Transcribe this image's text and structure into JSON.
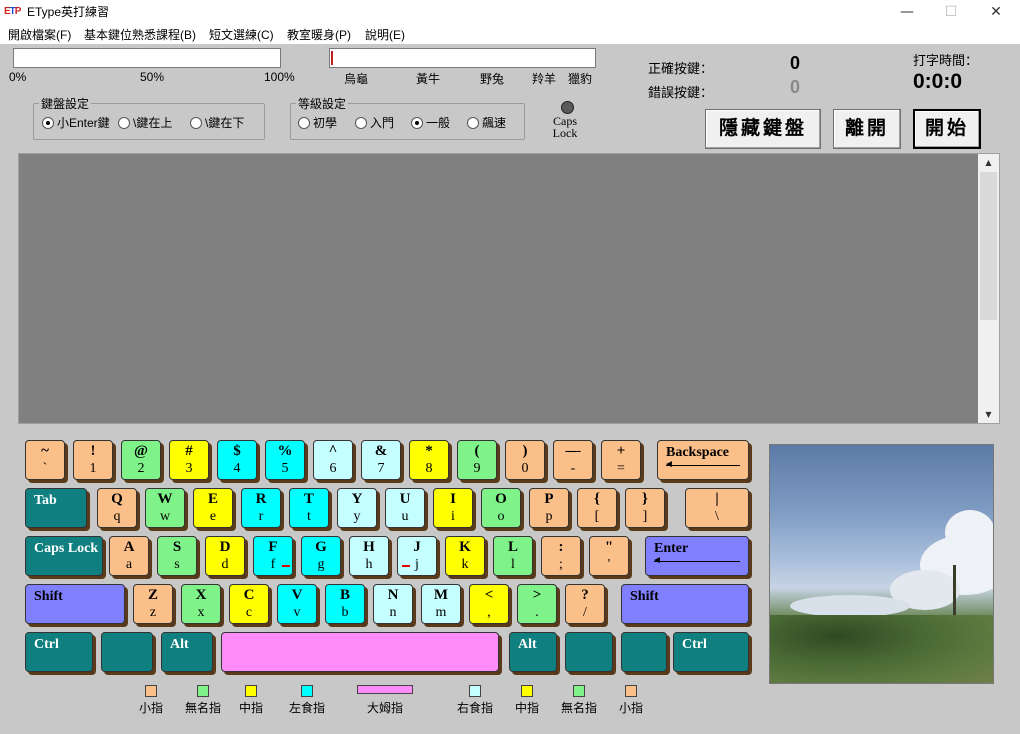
{
  "window": {
    "title": "EType英打練習",
    "icon_text_a": "E",
    "icon_text_b": "T",
    "icon_text_c": "P",
    "minimize": "—",
    "maximize": "☐",
    "close": "✕"
  },
  "menu": [
    "開啟檔案(F)",
    "基本鍵位熟悉課程(B)",
    "短文選練(C)",
    "教室暖身(P)",
    "說明(E)"
  ],
  "progress": {
    "scale_labels": [
      "0%",
      "50%",
      "100%"
    ],
    "value": 0,
    "speed_labels": [
      "烏龜",
      "黃牛",
      "野兔",
      "羚羊",
      "獵豹"
    ],
    "speed_value": 0
  },
  "stats": {
    "correct_label": "正確按鍵：",
    "correct_value": "0",
    "wrong_label": "錯誤按鍵：",
    "wrong_value": "0",
    "time_label": "打字時間：",
    "time_value": "0:0:0"
  },
  "keyboard_settings": {
    "title": "鍵盤設定",
    "options": [
      "小Enter鍵",
      "\\鍵在上",
      "\\鍵在下"
    ],
    "selected": "小Enter鍵"
  },
  "level_settings": {
    "title": "等級設定",
    "options": [
      "初學",
      "入門",
      "一般",
      "飆速"
    ],
    "selected": "一般"
  },
  "caps_lock": {
    "line1": "Caps",
    "line2": "Lock"
  },
  "buttons": {
    "hide_keyboard": "隱藏鍵盤",
    "exit": "離開",
    "start": "開始"
  },
  "colors": {
    "pinky": "#fbbf8a",
    "ring": "#7ff28a",
    "middle": "#ffff00",
    "index_left": "#00ffff",
    "index_right": "#c6ffff",
    "thumb": "#ff8cf8",
    "teal": "#0f7f7f",
    "blue": "#7f7fff"
  },
  "keyboard": {
    "row1": [
      {
        "u": "~",
        "l": "`"
      },
      {
        "u": "!",
        "l": "1"
      },
      {
        "u": "@",
        "l": "2"
      },
      {
        "u": "#",
        "l": "3"
      },
      {
        "u": "$",
        "l": "4"
      },
      {
        "u": "%",
        "l": "5"
      },
      {
        "u": "^",
        "l": "6"
      },
      {
        "u": "&",
        "l": "7"
      },
      {
        "u": "*",
        "l": "8"
      },
      {
        "u": "(",
        "l": "9"
      },
      {
        "u": ")",
        "l": "0"
      },
      {
        "u": "—",
        "l": "-"
      },
      {
        "u": "+",
        "l": "="
      }
    ],
    "backspace": "Backspace",
    "tab": "Tab",
    "row2": [
      {
        "u": "Q",
        "l": "q"
      },
      {
        "u": "W",
        "l": "w"
      },
      {
        "u": "E",
        "l": "e"
      },
      {
        "u": "R",
        "l": "r"
      },
      {
        "u": "T",
        "l": "t"
      },
      {
        "u": "Y",
        "l": "y"
      },
      {
        "u": "U",
        "l": "u"
      },
      {
        "u": "I",
        "l": "i"
      },
      {
        "u": "O",
        "l": "o"
      },
      {
        "u": "P",
        "l": "p"
      },
      {
        "u": "{",
        "l": "["
      },
      {
        "u": "}",
        "l": "]"
      },
      {
        "u": "|",
        "l": "\\"
      }
    ],
    "caps": "Caps Lock",
    "row3": [
      {
        "u": "A",
        "l": "a"
      },
      {
        "u": "S",
        "l": "s"
      },
      {
        "u": "D",
        "l": "d"
      },
      {
        "u": "F",
        "l": "f"
      },
      {
        "u": "G",
        "l": "g"
      },
      {
        "u": "H",
        "l": "h"
      },
      {
        "u": "J",
        "l": "j"
      },
      {
        "u": "K",
        "l": "k"
      },
      {
        "u": "L",
        "l": "l"
      },
      {
        "u": ":",
        "l": ";"
      },
      {
        "u": "\"",
        "l": "'"
      }
    ],
    "enter": "Enter",
    "shift": "Shift",
    "row4": [
      {
        "u": "Z",
        "l": "z"
      },
      {
        "u": "X",
        "l": "x"
      },
      {
        "u": "C",
        "l": "c"
      },
      {
        "u": "V",
        "l": "v"
      },
      {
        "u": "B",
        "l": "b"
      },
      {
        "u": "N",
        "l": "n"
      },
      {
        "u": "M",
        "l": "m"
      },
      {
        "u": "<",
        "l": ","
      },
      {
        "u": ">",
        "l": "."
      },
      {
        "u": "?",
        "l": "/"
      }
    ],
    "ctrl": "Ctrl",
    "alt": "Alt"
  },
  "legend": [
    "小指",
    "無名指",
    "中指",
    "左食指",
    "大姆指",
    "右食指",
    "中指",
    "無名指",
    "小指"
  ]
}
